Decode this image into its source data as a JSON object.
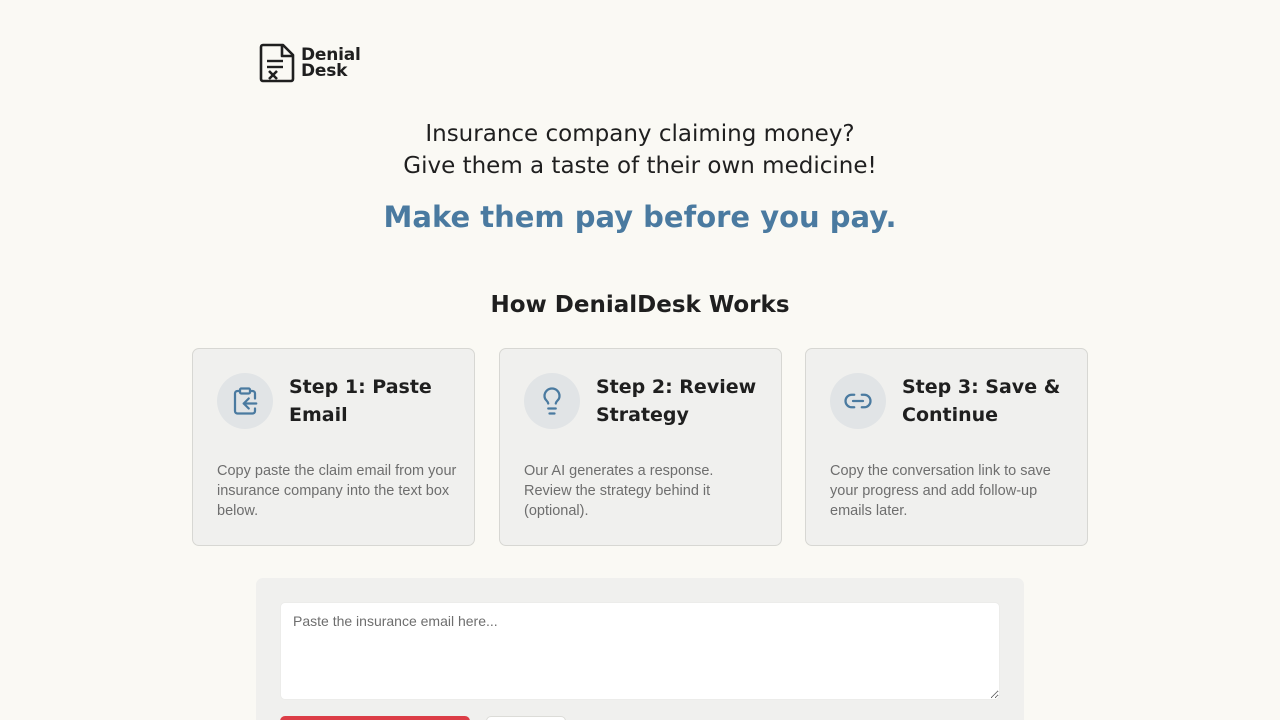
{
  "brand": {
    "line1": "Denial",
    "line2": "Desk",
    "logo_icon": "document-x-icon"
  },
  "hero": {
    "line1": "Insurance company claiming money?",
    "line2": "Give them a taste of their own medicine!",
    "cta": "Make them pay before you pay.",
    "cta_color": "#4a7aa0"
  },
  "how_it_works": {
    "title": "How DenialDesk Works",
    "steps": [
      {
        "title": "Step 1: Paste Email",
        "description": "Copy paste the claim email from your insurance company into the text box below.",
        "icon": "clipboard-arrow-icon"
      },
      {
        "title": "Step 2: Review Strategy",
        "description": "Our AI generates a response. Review the strategy behind it (optional).",
        "icon": "lightbulb-icon"
      },
      {
        "title": "Step 3: Save & Continue",
        "description": "Copy the conversation link to save your progress and add follow-up emails later.",
        "icon": "link-icon"
      }
    ]
  },
  "form": {
    "email_placeholder": "Paste the insurance email here...",
    "email_value": "",
    "primary_button_color": "#dc3d46"
  }
}
